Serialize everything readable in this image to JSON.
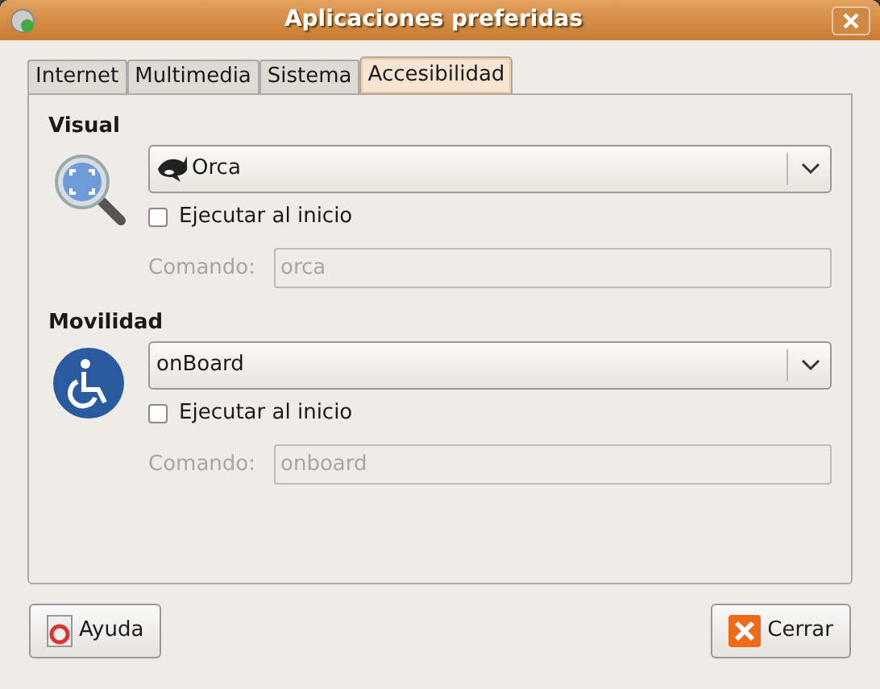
{
  "window": {
    "title": "Aplicaciones preferidas"
  },
  "tabs": [
    {
      "label": "Internet",
      "selected": false
    },
    {
      "label": "Multimedia",
      "selected": false
    },
    {
      "label": "Sistema",
      "selected": false
    },
    {
      "label": "Accesibilidad",
      "selected": true
    }
  ],
  "sections": [
    {
      "heading": "Visual",
      "combo": "Orca",
      "run_at_start": {
        "label": "Ejecutar al inicio",
        "checked": false
      },
      "command": {
        "label": "Comando:",
        "value": "orca",
        "disabled": true
      }
    },
    {
      "heading": "Movilidad",
      "combo": "onBoard",
      "run_at_start": {
        "label": "Ejecutar al inicio",
        "checked": false
      },
      "command": {
        "label": "Comando:",
        "value": "onboard",
        "disabled": true
      }
    }
  ],
  "buttons": {
    "help": "Ayuda",
    "close": "Cerrar"
  }
}
